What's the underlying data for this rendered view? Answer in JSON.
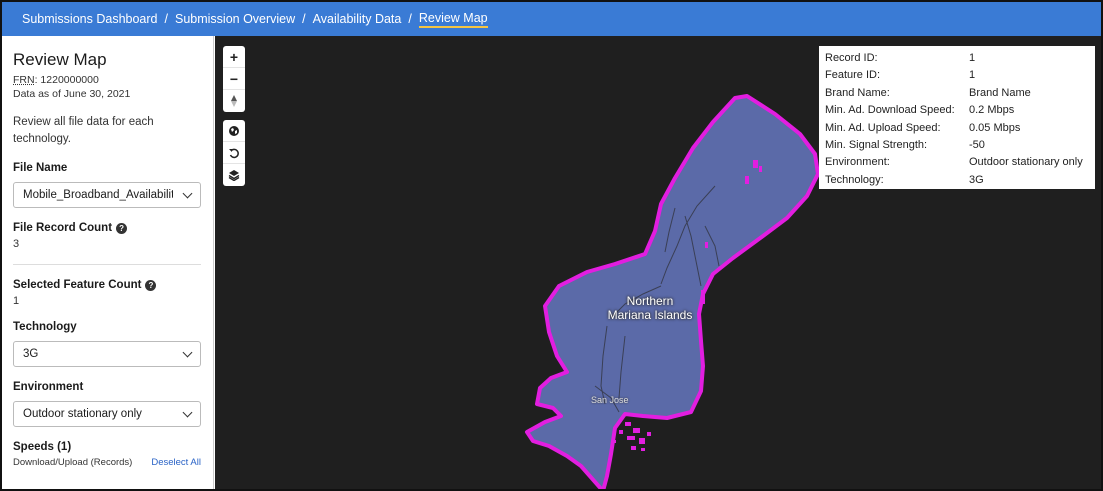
{
  "breadcrumb": [
    {
      "label": "Submissions Dashboard"
    },
    {
      "label": "Submission Overview"
    },
    {
      "label": "Availability Data"
    },
    {
      "label": "Review Map"
    }
  ],
  "sidebar": {
    "title": "Review Map",
    "frn_label": "FRN",
    "frn_value": ": 1220000000",
    "data_as_of": "Data as of June 30, 2021",
    "description": "Review all file data for each technology.",
    "file_name_label": "File Name",
    "file_name_value": "Mobile_Broadband_Availabilit",
    "file_record_count_label": "File Record Count",
    "file_record_count_value": "3",
    "selected_feature_count_label": "Selected Feature Count",
    "selected_feature_count_value": "1",
    "technology_label": "Technology",
    "technology_value": "3G",
    "environment_label": "Environment",
    "environment_value": "Outdoor stationary only",
    "speeds_label": "Speeds (1)",
    "speeds_sub": "Download/Upload (Records)",
    "deselect_all": "Deselect All",
    "help_glyph": "?"
  },
  "map_controls": {
    "zoom_in": "+",
    "zoom_out": "−"
  },
  "popup": {
    "rows": [
      {
        "key": "Record ID:",
        "value": "1"
      },
      {
        "key": "Feature ID:",
        "value": "1"
      },
      {
        "key": "Brand Name:",
        "value": "Brand Name"
      },
      {
        "key": "Min. Ad. Download Speed:",
        "value": "0.2 Mbps"
      },
      {
        "key": "Min. Ad. Upload Speed:",
        "value": "0.05 Mbps"
      },
      {
        "key": "Min. Signal Strength:",
        "value": "-50"
      },
      {
        "key": "Environment:",
        "value": "Outdoor stationary only"
      },
      {
        "key": "Technology:",
        "value": "3G"
      }
    ]
  },
  "map": {
    "region_label_line1": "Northern",
    "region_label_line2": "Mariana Islands",
    "town_label": "San Jose",
    "fill_color": "#5b6aa8",
    "outline_color": "#e21ee0",
    "background_color": "#1f1f1f"
  },
  "colors": {
    "header_bg": "#3a7bd5",
    "breadcrumb_underline": "#f5c542",
    "link": "#2a63c6"
  }
}
